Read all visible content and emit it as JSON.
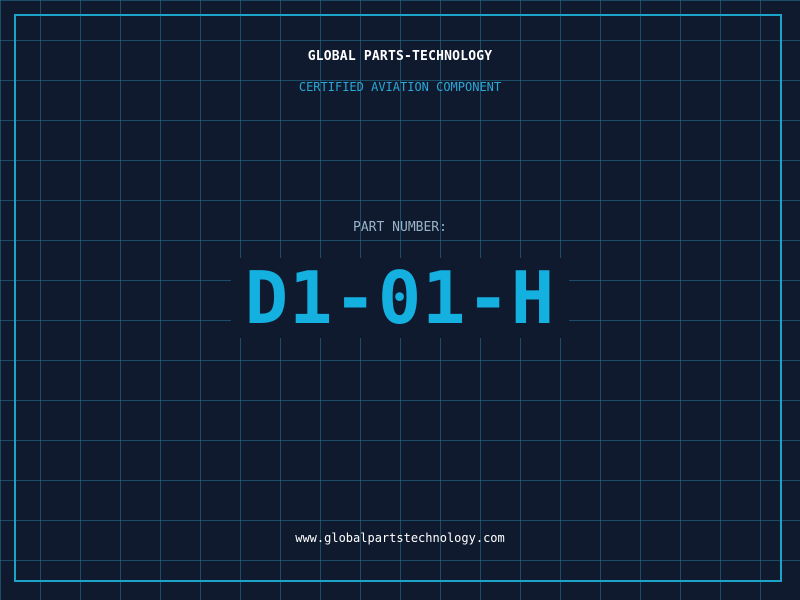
{
  "label": {
    "company": "GLOBAL PARTS-TECHNOLOGY",
    "subtitle": "CERTIFIED AVIATION COMPONENT",
    "part_label": "PART NUMBER:",
    "part_number": "D1-01-H",
    "website": "www.globalpartstechnology.com"
  },
  "colors": {
    "background": "#101a2f",
    "grid": "#288caa",
    "frame": "#1ba3c9",
    "accent": "#13b0e0",
    "subtitle": "#2aa7d6"
  }
}
